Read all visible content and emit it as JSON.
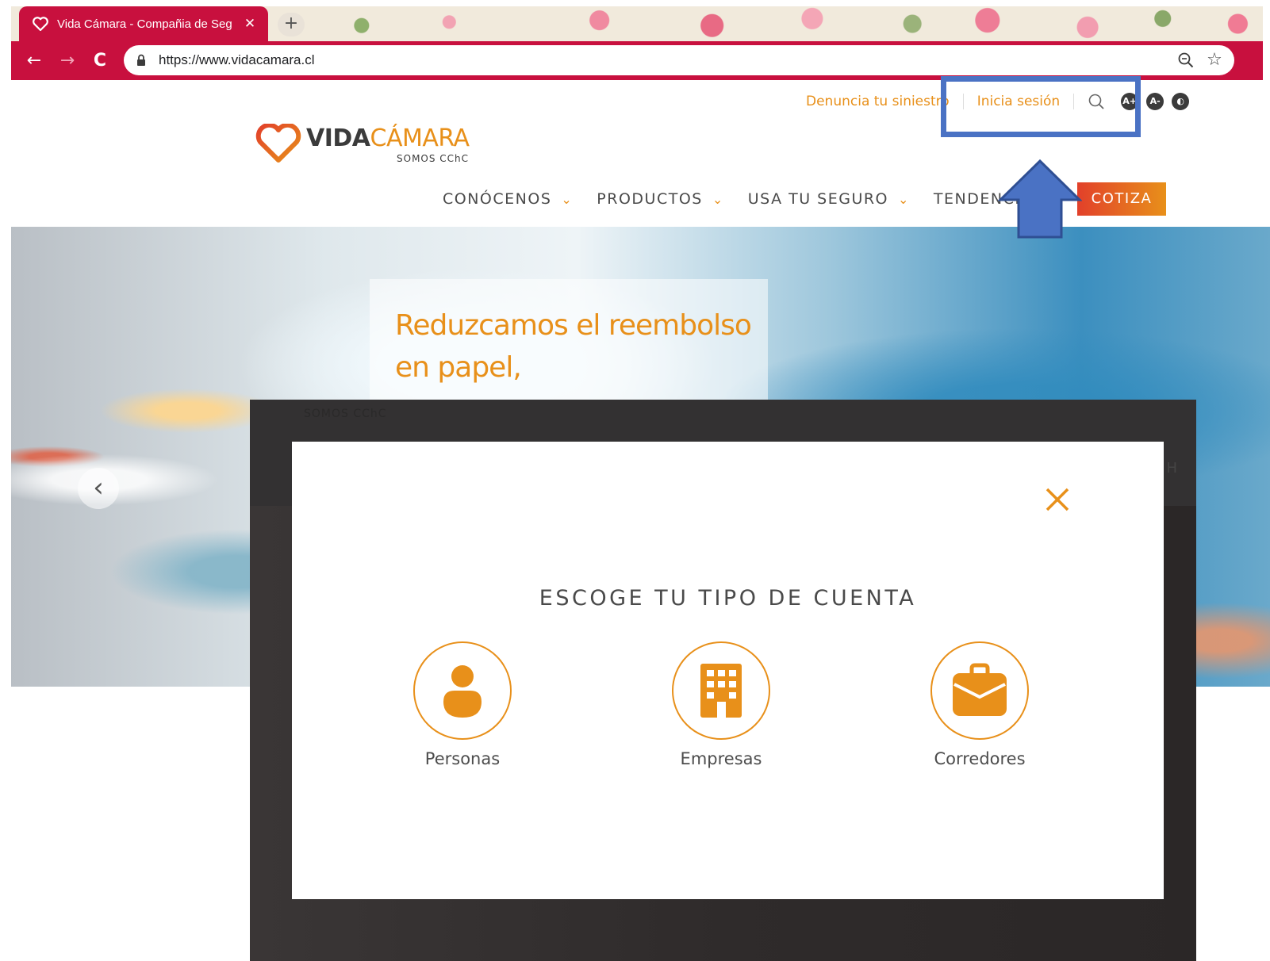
{
  "browser": {
    "tab_title": "Vida Cámara - Compañia de Seg",
    "tab_close": "✕",
    "new_tab": "+",
    "back": "←",
    "forward": "→",
    "reload": "C",
    "url": "https://www.vidacamara.cl",
    "bookmark": "☆"
  },
  "site": {
    "topbar": {
      "report_claim": "Denuncia tu siniestro",
      "login": "Inicia sesión",
      "accessibility": [
        "A+",
        "A-",
        "◐"
      ]
    },
    "logo": {
      "word_bold": "VIDA",
      "word_light": "CÁMARA",
      "tagline": "SOMOS CChC"
    },
    "nav": [
      {
        "label": "CONÓCENOS",
        "chevron": "⌄"
      },
      {
        "label": "PRODUCTOS",
        "chevron": "⌄"
      },
      {
        "label": "USA TU SEGURO",
        "chevron": "⌄"
      },
      {
        "label": "TENDENCIAS",
        "chevron": ""
      }
    ],
    "cta": "COTIZA",
    "hero": {
      "text": "Reduzcamos el reembolso en papel,",
      "prev": "‹"
    }
  },
  "overlay": {
    "ghost_tagline": "SOMOS CChC",
    "ghost_letter": "H"
  },
  "modal": {
    "title": "ESCOGE TU TIPO DE CUENTA",
    "options": [
      {
        "label": "Personas",
        "icon": "person-icon"
      },
      {
        "label": "Empresas",
        "icon": "building-icon"
      },
      {
        "label": "Corredores",
        "icon": "briefcase-icon"
      }
    ]
  },
  "colors": {
    "brand_orange": "#e8901a",
    "browser_red": "#c8103e",
    "annotation_blue": "#4a72c4",
    "cta_red": "#e2402a"
  }
}
